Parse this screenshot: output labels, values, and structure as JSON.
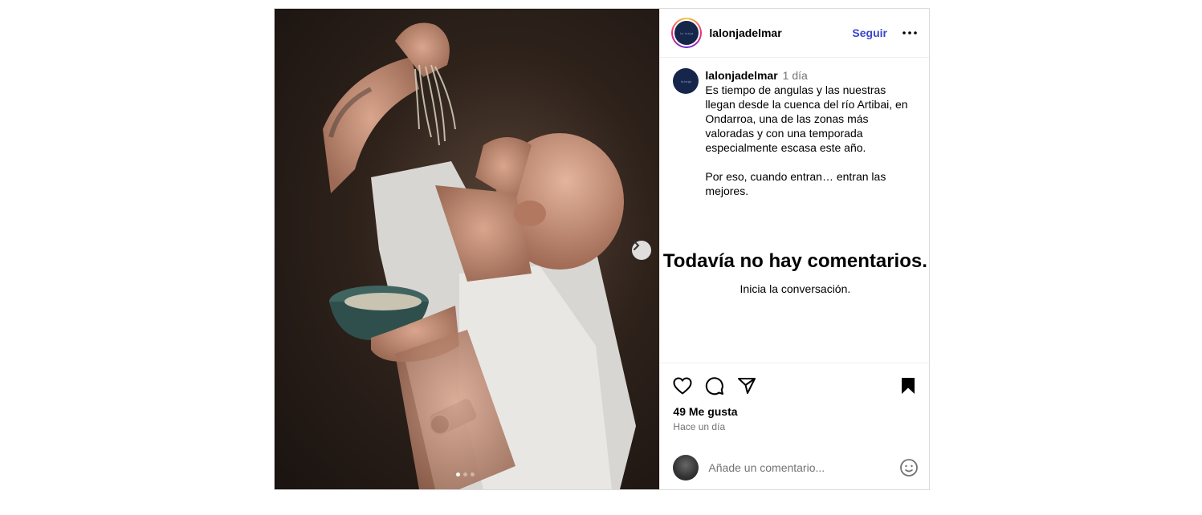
{
  "post": {
    "author": "lalonjadelmar",
    "follow_label": "Seguir",
    "avatar_text": "la lonja",
    "caption": {
      "author": "lalonjadelmar",
      "time": "1 día",
      "text": "Es tiempo de angulas y las nuestras llegan desde la cuenca del río Artibai, en Ondarroa, una de las zonas más valoradas y con una temporada especialmente escasa este año.\n\nPor eso, cuando entran… entran las mejores."
    },
    "empty_comments": {
      "title": "Todavía no hay comentarios.",
      "subtitle": "Inicia la conversación."
    },
    "likes": "49 Me gusta",
    "posted_ago": "Hace un día",
    "comment_placeholder": "Añade un comentario...",
    "carousel": {
      "count": 3,
      "active": 1
    }
  },
  "icons": {
    "more": "more-horizontal-icon",
    "next": "chevron-right-icon",
    "like": "heart-icon",
    "comment": "comment-icon",
    "share": "send-icon",
    "save": "bookmark-icon",
    "emoji": "emoji-icon"
  },
  "colors": {
    "follow": "#3a44c7",
    "secondary_text": "#737373",
    "border": "#dbdbdb"
  }
}
